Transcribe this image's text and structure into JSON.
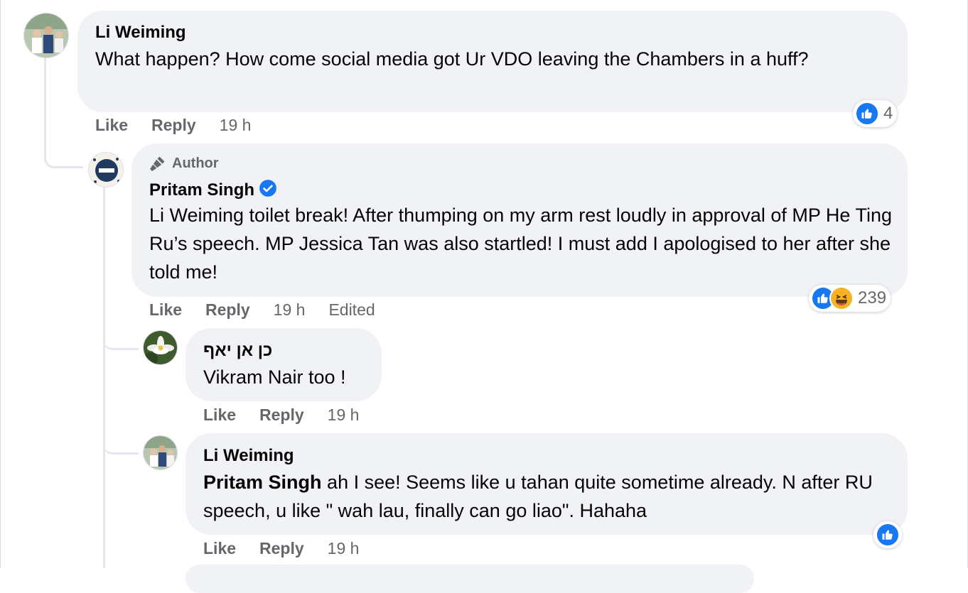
{
  "actions": {
    "like": "Like",
    "reply": "Reply"
  },
  "comments": [
    {
      "author": "Li Weiming",
      "text": "What happen? How come social media got Ur VDO leaving the Chambers in a huff?",
      "time": "19 h",
      "reaction_count": "4"
    },
    {
      "author_badge": "Author",
      "author": "Pritam Singh",
      "verified": true,
      "text": "Li Weiming toilet break! After thumping on my arm rest loudly in approval of MP He Ting Ru’s speech. MP Jessica Tan was also startled! I must add I apologised to her after she told me!",
      "time": "19 h",
      "edited": "Edited",
      "reaction_count": "239"
    },
    {
      "author": "כן אן יאף",
      "text": "Vikram Nair too !",
      "time": "19 h"
    },
    {
      "author": "Li Weiming",
      "mention": "Pritam Singh",
      "text": "ah I see! Seems like u tahan quite sometime already. N after RU speech, u like \" wah lau, finally can go liao\". Hahaha",
      "time": "19 h"
    }
  ],
  "colors": {
    "bubble": "#f0f2f5",
    "like_blue": "#1877f2",
    "meta_gray": "#65676b"
  }
}
